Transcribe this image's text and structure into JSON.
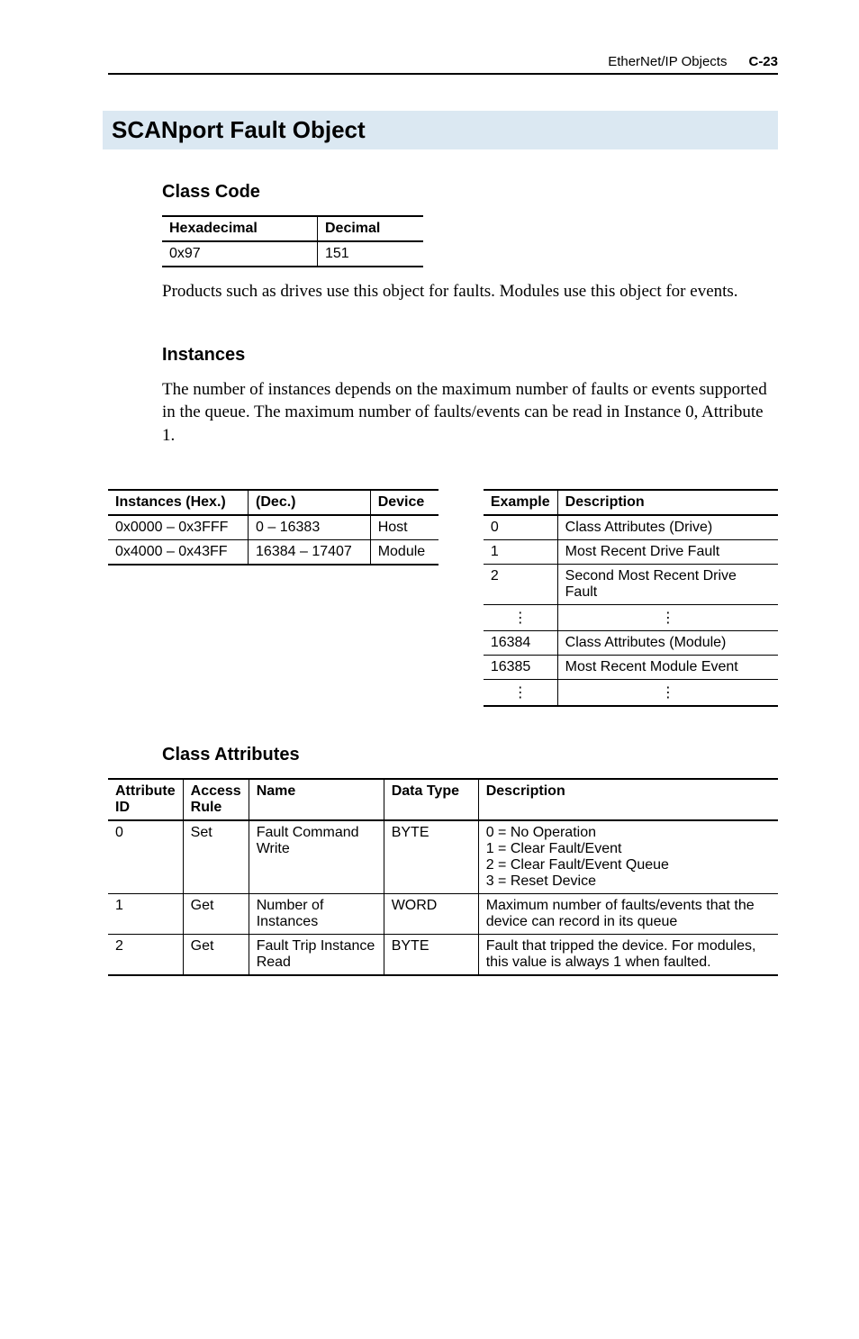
{
  "header": {
    "section": "EtherNet/IP Objects",
    "page": "C-23"
  },
  "title": "SCANport Fault Object",
  "class_code": {
    "heading": "Class Code",
    "cols": [
      "Hexadecimal",
      "Decimal"
    ],
    "row": [
      "0x97",
      "151"
    ],
    "para": "Products such as drives use this object for faults. Modules use this object for events."
  },
  "instances": {
    "heading": "Instances",
    "para": "The number of instances depends on the maximum number of faults or events supported in the queue. The maximum number of faults/events can be read in Instance 0, Attribute 1.",
    "left_cols": [
      "Instances (Hex.)",
      "(Dec.)",
      "Device"
    ],
    "left_rows": [
      [
        "0x0000 – 0x3FFF",
        "0 – 16383",
        "Host"
      ],
      [
        "0x4000 – 0x43FF",
        "16384 – 17407",
        "Module"
      ]
    ],
    "right_cols": [
      "Example",
      "Description"
    ],
    "right_rows": [
      [
        "0",
        "Class Attributes (Drive)"
      ],
      [
        "1",
        "Most Recent Drive Fault"
      ],
      [
        "2",
        "Second Most Recent Drive Fault"
      ],
      [
        "⋮",
        "⋮"
      ],
      [
        "16384",
        "Class Attributes (Module)"
      ],
      [
        "16385",
        "Most Recent Module Event"
      ],
      [
        "⋮",
        "⋮"
      ]
    ]
  },
  "class_attr": {
    "heading": "Class Attributes",
    "cols": [
      "Attribute ID",
      "Access Rule",
      "Name",
      "Data Type",
      "Description"
    ],
    "rows": [
      [
        "0",
        "Set",
        "Fault Command Write",
        "BYTE",
        "0 = No Operation\n1 = Clear Fault/Event\n2 = Clear Fault/Event Queue\n3 = Reset Device"
      ],
      [
        "1",
        "Get",
        "Number of Instances",
        "WORD",
        "Maximum number of faults/events that the device can record in its queue"
      ],
      [
        "2",
        "Get",
        "Fault Trip Instance Read",
        "BYTE",
        "Fault that tripped the device. For modules, this value is always 1 when faulted."
      ]
    ]
  }
}
